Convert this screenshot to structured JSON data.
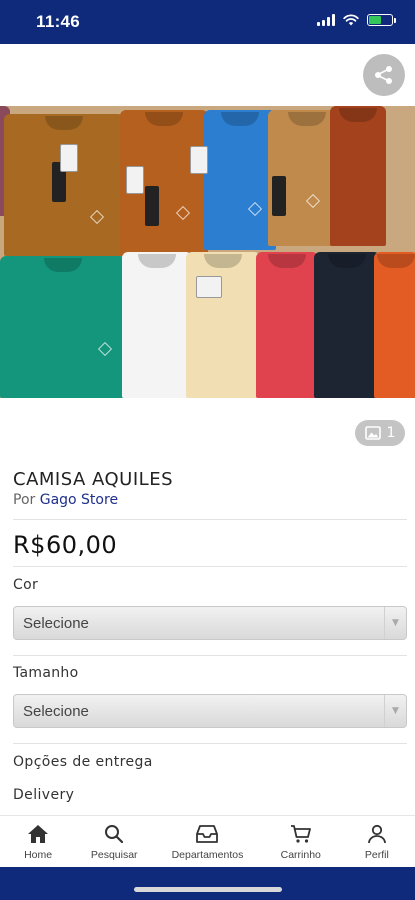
{
  "status_bar": {
    "time": "11:46",
    "background": "#0f2a7a",
    "icons": [
      "signal-icon",
      "wifi-icon",
      "battery-charging-icon"
    ]
  },
  "product": {
    "title": "CAMISA AQUILES",
    "seller_prefix": "Por",
    "seller_name": "Gago Store",
    "price": "R$60,00",
    "photo_count": "1"
  },
  "options": {
    "color_label": "Cor",
    "color_value": "Selecione",
    "size_label": "Tamanho",
    "size_value": "Selecione"
  },
  "delivery": {
    "heading": "Opções de entrega",
    "method": "Delivery"
  },
  "tab_bar": {
    "items": [
      {
        "label": "Home",
        "icon": "home-icon"
      },
      {
        "label": "Pesquisar",
        "icon": "search-icon"
      },
      {
        "label": "Departamentos",
        "icon": "inbox-icon"
      },
      {
        "label": "Carrinho",
        "icon": "cart-icon"
      },
      {
        "label": "Perfil",
        "icon": "user-icon"
      }
    ]
  },
  "colors": {
    "brand": "#0f2a7a",
    "seller_link": "#1f2f8a"
  }
}
